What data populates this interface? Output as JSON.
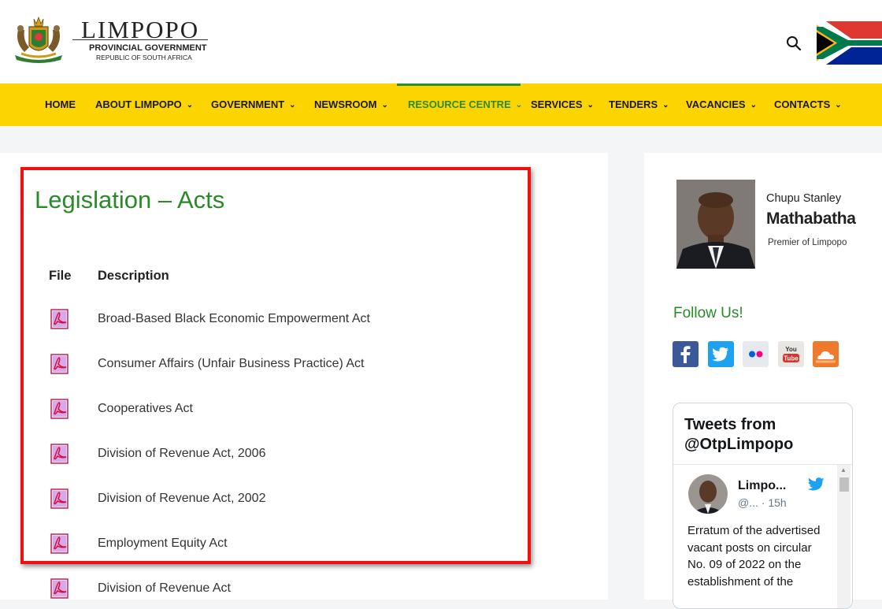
{
  "header": {
    "logo_title": "LIMPOPO",
    "logo_subtitle": "PROVINCIAL GOVERNMENT",
    "logo_country": "REPUBLIC OF SOUTH AFRICA",
    "search_icon": "search-icon"
  },
  "nav": {
    "items": [
      {
        "label": "HOME"
      },
      {
        "label": "ABOUT LIMPOPO"
      },
      {
        "label": "GOVERNMENT"
      },
      {
        "label": "NEWSROOM"
      },
      {
        "label": "RESOURCE CENTRE"
      },
      {
        "label": "SERVICES"
      },
      {
        "label": "TENDERS"
      },
      {
        "label": "VACANCIES"
      },
      {
        "label": "CONTACTS"
      }
    ],
    "active": "RESOURCE CENTRE",
    "chevron": "⌄"
  },
  "main": {
    "title": "Legislation – Acts",
    "columns": {
      "file": "File",
      "description": "Description"
    },
    "rows": [
      {
        "description": "Broad-Based Black Economic Empowerment Act"
      },
      {
        "description": "Consumer Affairs (Unfair Business Practice) Act"
      },
      {
        "description": "Cooperatives Act"
      },
      {
        "description": "Division of Revenue Act, 2006"
      },
      {
        "description": "Division of Revenue Act, 2002"
      },
      {
        "description": "Employment Equity Act"
      },
      {
        "description": "Division of Revenue Act"
      }
    ]
  },
  "sidebar": {
    "premier": {
      "first_name": "Chupu Stanley",
      "last_name": "Mathabatha",
      "role": "Premier of Limpopo"
    },
    "follow_title": "Follow Us!",
    "social": [
      "facebook-icon",
      "twitter-icon",
      "flickr-icon",
      "youtube-icon",
      "soundcloud-icon"
    ],
    "twitter": {
      "title": "Tweets from @OtpLimpopo",
      "name": "Limpo...",
      "handle": "@... · 15h",
      "text": "Erratum of the advertised vacant posts on circular No. 09 of 2022 on the establishment of the"
    }
  },
  "colors": {
    "nav_bg": "#fcd500",
    "accent_green": "#2a8a2a",
    "highlight_red": "#f01010"
  }
}
